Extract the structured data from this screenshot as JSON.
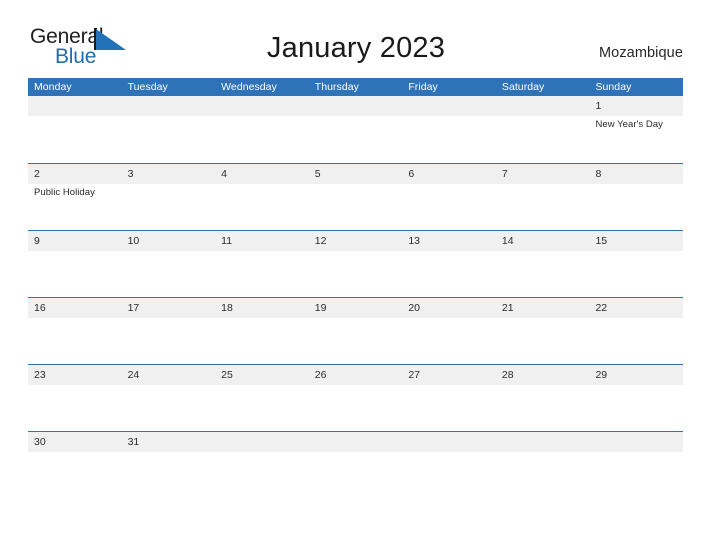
{
  "logo": {
    "word_dark": "General",
    "word_blue": "Blue",
    "triangle_color": "#2272b8",
    "blue_color": "#1f6cb5"
  },
  "header": {
    "title": "January 2023",
    "country": "Mozambique"
  },
  "theme": {
    "header_blue": "#2e73b8",
    "row_band_gray": "#f0f0f0",
    "text_dark": "#2b2b2b",
    "page_background": "#ffffff"
  },
  "calendar": {
    "weekdays": [
      "Monday",
      "Tuesday",
      "Wednesday",
      "Thursday",
      "Friday",
      "Saturday",
      "Sunday"
    ],
    "weeks": [
      [
        {
          "date": "",
          "events": []
        },
        {
          "date": "",
          "events": []
        },
        {
          "date": "",
          "events": []
        },
        {
          "date": "",
          "events": []
        },
        {
          "date": "",
          "events": []
        },
        {
          "date": "",
          "events": []
        },
        {
          "date": "1",
          "events": [
            "New Year's Day"
          ]
        }
      ],
      [
        {
          "date": "2",
          "events": [
            "Public Holiday"
          ]
        },
        {
          "date": "3",
          "events": []
        },
        {
          "date": "4",
          "events": []
        },
        {
          "date": "5",
          "events": []
        },
        {
          "date": "6",
          "events": []
        },
        {
          "date": "7",
          "events": []
        },
        {
          "date": "8",
          "events": []
        }
      ],
      [
        {
          "date": "9",
          "events": []
        },
        {
          "date": "10",
          "events": []
        },
        {
          "date": "11",
          "events": []
        },
        {
          "date": "12",
          "events": []
        },
        {
          "date": "13",
          "events": []
        },
        {
          "date": "14",
          "events": []
        },
        {
          "date": "15",
          "events": []
        }
      ],
      [
        {
          "date": "16",
          "events": []
        },
        {
          "date": "17",
          "events": []
        },
        {
          "date": "18",
          "events": []
        },
        {
          "date": "19",
          "events": []
        },
        {
          "date": "20",
          "events": []
        },
        {
          "date": "21",
          "events": []
        },
        {
          "date": "22",
          "events": []
        }
      ],
      [
        {
          "date": "23",
          "events": []
        },
        {
          "date": "24",
          "events": []
        },
        {
          "date": "25",
          "events": []
        },
        {
          "date": "26",
          "events": []
        },
        {
          "date": "27",
          "events": []
        },
        {
          "date": "28",
          "events": []
        },
        {
          "date": "29",
          "events": []
        }
      ],
      [
        {
          "date": "30",
          "events": []
        },
        {
          "date": "31",
          "events": []
        },
        {
          "date": "",
          "events": []
        },
        {
          "date": "",
          "events": []
        },
        {
          "date": "",
          "events": []
        },
        {
          "date": "",
          "events": []
        },
        {
          "date": "",
          "events": []
        }
      ]
    ]
  }
}
